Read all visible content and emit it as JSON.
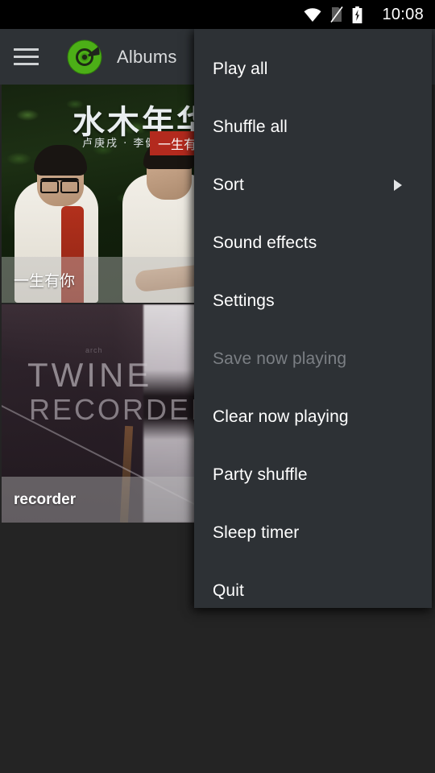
{
  "status_bar": {
    "clock": "10:08",
    "icons": [
      {
        "name": "wifi-icon",
        "glyph": "wifi"
      },
      {
        "name": "no-sim-icon",
        "glyph": "sim-crossed"
      },
      {
        "name": "battery-charging-icon",
        "glyph": "battery-charging"
      }
    ]
  },
  "toolbar": {
    "menu_icon": "hamburger-icon",
    "app_icon": "vinyl-disc-icon",
    "title": "Albums"
  },
  "albums": [
    {
      "label": "一生有你",
      "bold": false,
      "art": {
        "style": "photo-duo-foliage",
        "cover_title": "水木年华",
        "cover_subtitle": "卢庚戌 · 李健",
        "cover_band": "一生有"
      },
      "overflow_icon": "grid-dots-icon"
    },
    {
      "label": "recorder",
      "bold": true,
      "art": {
        "style": "twine-recorder",
        "word1": "TWINE",
        "word2": "RECORDER",
        "tiny": "arch"
      },
      "overflow_icon": "grid-dots-icon"
    }
  ],
  "overflow_menu": {
    "items": [
      {
        "label": "Play all",
        "disabled": false,
        "submenu": false
      },
      {
        "label": "Shuffle all",
        "disabled": false,
        "submenu": false
      },
      {
        "label": "Sort",
        "disabled": false,
        "submenu": true
      },
      {
        "label": "Sound effects",
        "disabled": false,
        "submenu": false
      },
      {
        "label": "Settings",
        "disabled": false,
        "submenu": false
      },
      {
        "label": "Save now playing",
        "disabled": true,
        "submenu": false
      },
      {
        "label": "Clear now playing",
        "disabled": false,
        "submenu": false
      },
      {
        "label": "Party shuffle",
        "disabled": false,
        "submenu": false
      },
      {
        "label": "Sleep timer",
        "disabled": false,
        "submenu": false
      },
      {
        "label": "Quit",
        "disabled": false,
        "submenu": false
      }
    ]
  },
  "colors": {
    "status_bar_bg": "#000000",
    "toolbar_bg": "#2e3236",
    "page_bg": "#242424",
    "menu_bg": "#2d3135",
    "menu_text": "#ffffff",
    "menu_text_disabled": "#7b7f84",
    "accent_green": "#4caf17",
    "title_text": "#d8dadc"
  }
}
